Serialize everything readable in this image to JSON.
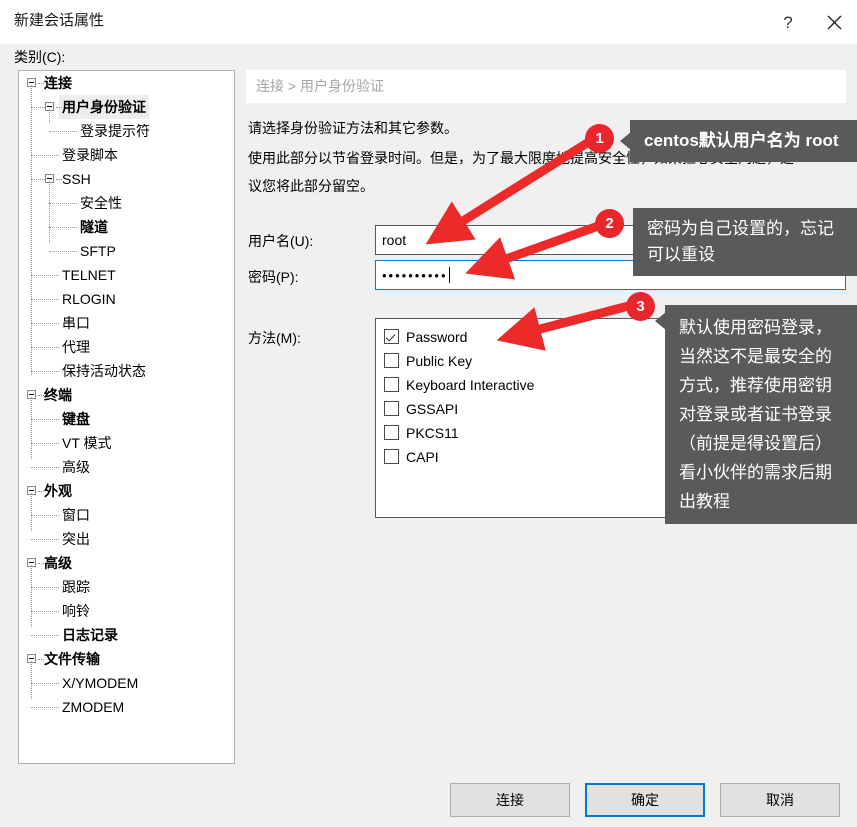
{
  "window": {
    "title": "新建会话属性",
    "help_icon": "question-mark-icon",
    "close_icon": "close-icon"
  },
  "category": {
    "label": "类别(C):",
    "tree": [
      {
        "label": "连接",
        "level": 0,
        "bold": true,
        "expander": true
      },
      {
        "label": "用户身份验证",
        "level": 1,
        "bold": true,
        "expander": true,
        "selected": true
      },
      {
        "label": "登录提示符",
        "level": 2,
        "bold": false,
        "expander": false
      },
      {
        "label": "登录脚本",
        "level": 1,
        "bold": false,
        "expander": false
      },
      {
        "label": "SSH",
        "level": 1,
        "bold": false,
        "expander": true
      },
      {
        "label": "安全性",
        "level": 2,
        "bold": false,
        "expander": false
      },
      {
        "label": "隧道",
        "level": 2,
        "bold": true,
        "expander": false
      },
      {
        "label": "SFTP",
        "level": 2,
        "bold": false,
        "expander": false
      },
      {
        "label": "TELNET",
        "level": 1,
        "bold": false,
        "expander": false
      },
      {
        "label": "RLOGIN",
        "level": 1,
        "bold": false,
        "expander": false
      },
      {
        "label": "串口",
        "level": 1,
        "bold": false,
        "expander": false
      },
      {
        "label": "代理",
        "level": 1,
        "bold": false,
        "expander": false
      },
      {
        "label": "保持活动状态",
        "level": 1,
        "bold": false,
        "expander": false
      },
      {
        "label": "终端",
        "level": 0,
        "bold": true,
        "expander": true
      },
      {
        "label": "键盘",
        "level": 1,
        "bold": true,
        "expander": false
      },
      {
        "label": "VT 模式",
        "level": 1,
        "bold": false,
        "expander": false
      },
      {
        "label": "高级",
        "level": 1,
        "bold": false,
        "expander": false
      },
      {
        "label": "外观",
        "level": 0,
        "bold": true,
        "expander": true
      },
      {
        "label": "窗口",
        "level": 1,
        "bold": false,
        "expander": false
      },
      {
        "label": "突出",
        "level": 1,
        "bold": false,
        "expander": false
      },
      {
        "label": "高级",
        "level": 0,
        "bold": true,
        "expander": true
      },
      {
        "label": "跟踪",
        "level": 1,
        "bold": false,
        "expander": false
      },
      {
        "label": "响铃",
        "level": 1,
        "bold": false,
        "expander": false
      },
      {
        "label": "日志记录",
        "level": 1,
        "bold": true,
        "expander": false
      },
      {
        "label": "文件传输",
        "level": 0,
        "bold": true,
        "expander": true
      },
      {
        "label": "X/YMODEM",
        "level": 1,
        "bold": false,
        "expander": false
      },
      {
        "label": "ZMODEM",
        "level": 1,
        "bold": false,
        "expander": false
      }
    ]
  },
  "main": {
    "breadcrumb": "连接 > 用户身份验证",
    "description_line1": "请选择身份验证方法和其它参数。",
    "description_line2": "使用此部分以节省登录时间。但是，为了最大限度地提高安全性，如果担心安全问题，建",
    "description_line3": "议您将此部分留空。",
    "username_label": "用户名(U):",
    "username_value": "root",
    "password_label": "密码(P):",
    "password_value": "••••••••••",
    "method_label": "方法(M):",
    "methods": [
      {
        "label": "Password",
        "checked": true
      },
      {
        "label": "Public Key",
        "checked": false
      },
      {
        "label": "Keyboard Interactive",
        "checked": false
      },
      {
        "label": "GSSAPI",
        "checked": false
      },
      {
        "label": "PKCS11",
        "checked": false
      },
      {
        "label": "CAPI",
        "checked": false
      }
    ]
  },
  "buttons": {
    "connect": "连接",
    "ok": "确定",
    "cancel": "取消"
  },
  "annotations": [
    {
      "number": "1",
      "text": "centos默认用户名为 root"
    },
    {
      "number": "2",
      "text": "密码为自己设置的，忘记可以重设"
    },
    {
      "number": "3",
      "text": "默认使用密码登录，当然这不是最安全的方式，推荐使用密钥对登录或者证书登录（前提是得设置后）看小伙伴的需求后期出教程"
    }
  ],
  "colors": {
    "dialog_background": "#f0f0f0",
    "accent_focus": "#0078d7",
    "annotation_red": "#e8262b",
    "tooltip_background": "#5a5a5a",
    "breadcrumb_text": "#a6a6a6"
  }
}
